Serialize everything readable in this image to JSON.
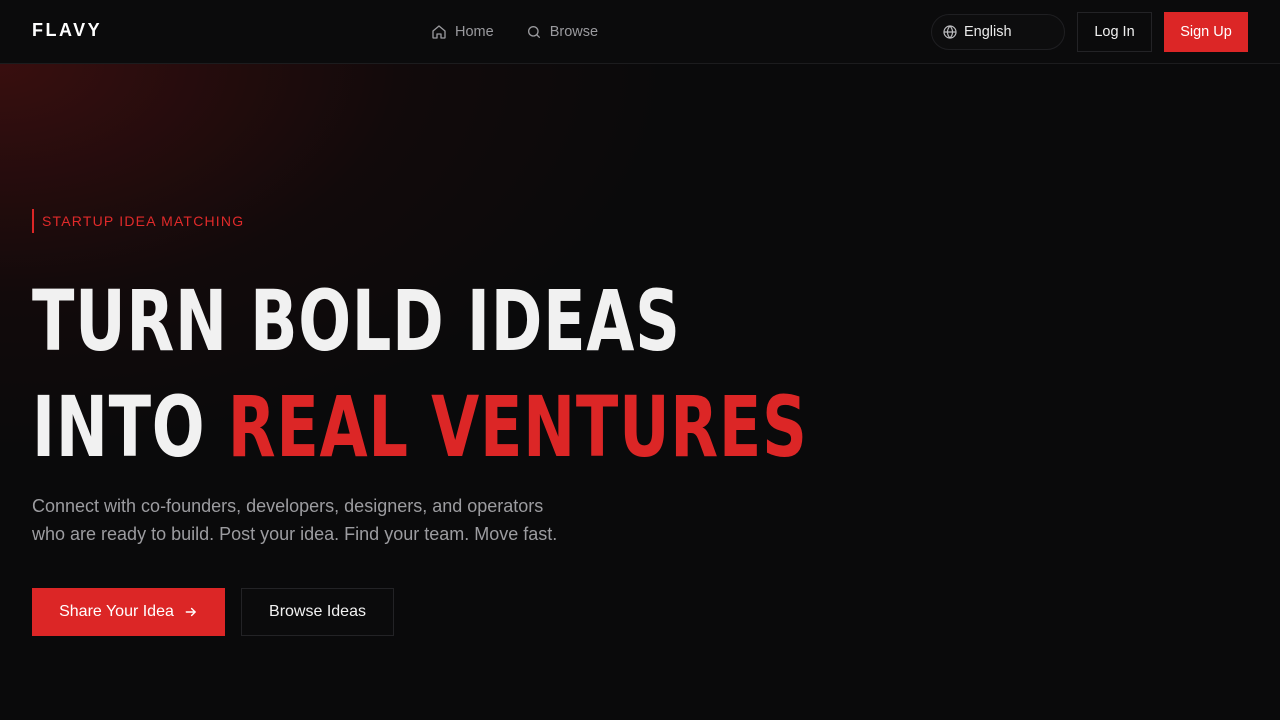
{
  "header": {
    "logo": "FLAVY",
    "nav": [
      {
        "label": "Home",
        "icon": "home-icon"
      },
      {
        "label": "Browse",
        "icon": "search-icon"
      }
    ],
    "language": {
      "label": "English",
      "icon": "globe-icon"
    },
    "login_label": "Log In",
    "signup_label": "Sign Up"
  },
  "hero": {
    "eyebrow": "STARTUP IDEA MATCHING",
    "headline_line1": "TURN BOLD IDEAS",
    "headline_line2_plain": "INTO",
    "headline_line2_accent": "REAL VENTURES",
    "subtext_line1": "Connect with co-founders, developers, designers, and operators",
    "subtext_line2": "who are ready to build. Post your idea. Find your team. Move fast.",
    "primary_cta": "Share Your Idea",
    "primary_cta_icon": "arrow-right-icon",
    "secondary_cta": "Browse Ideas"
  },
  "colors": {
    "accent": "#dc2626",
    "background": "#0a0a0b",
    "muted_text": "#9c9ca0"
  }
}
